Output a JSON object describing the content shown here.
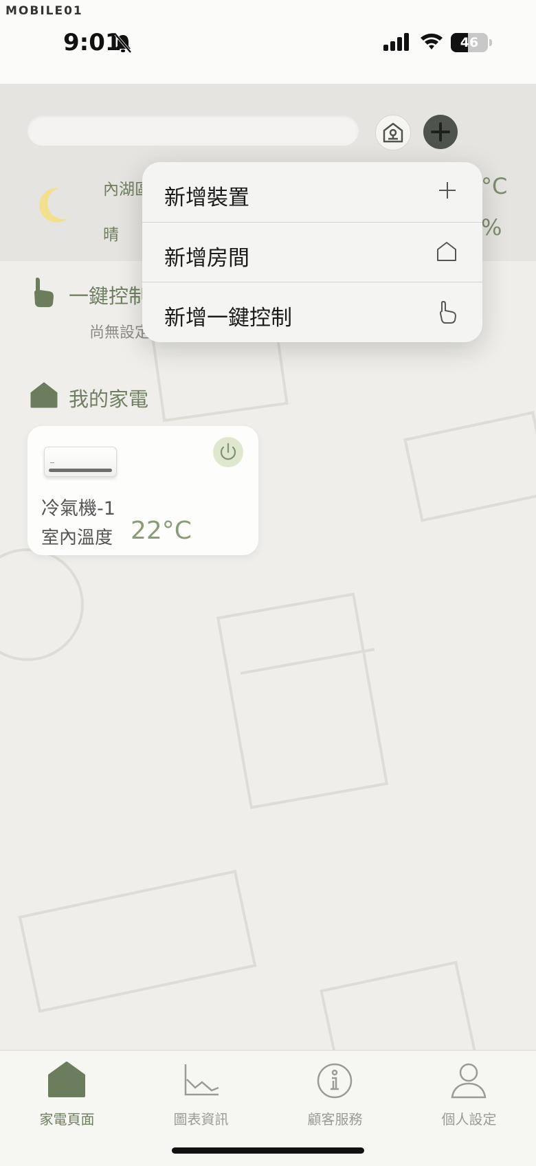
{
  "status": {
    "watermark": "MOBILE01",
    "time": "9:01",
    "battery": "46",
    "battery_level": 0.46
  },
  "weather": {
    "location": "內湖區",
    "condition": "晴",
    "temperature_suffix": "°C",
    "humidity_suffix": "%"
  },
  "header": {
    "search_placeholder": "",
    "room_icon": "house-icon",
    "add_icon": "plus-icon"
  },
  "quick_control": {
    "title": "一鍵控制",
    "empty_text": "尚無設定"
  },
  "appliances": {
    "title": "我的家電",
    "devices": [
      {
        "name": "冷氣機-1",
        "temp_label": "室內溫度",
        "temp_value": "22°C"
      }
    ]
  },
  "add_menu": {
    "items": [
      {
        "label": "新增裝置",
        "icon": "plus-icon"
      },
      {
        "label": "新增房間",
        "icon": "house-outline-icon"
      },
      {
        "label": "新增一鍵控制",
        "icon": "hand-pointer-icon"
      }
    ]
  },
  "tabs": [
    {
      "label": "家電頁面",
      "icon": "home-icon",
      "active": true
    },
    {
      "label": "圖表資訊",
      "icon": "chart-icon",
      "active": false
    },
    {
      "label": "顧客服務",
      "icon": "info-icon",
      "active": false
    },
    {
      "label": "個人設定",
      "icon": "person-icon",
      "active": false
    }
  ],
  "colors": {
    "accent": "#6f7f62",
    "background": "#efeeea",
    "menu": "#f4f4f2"
  }
}
